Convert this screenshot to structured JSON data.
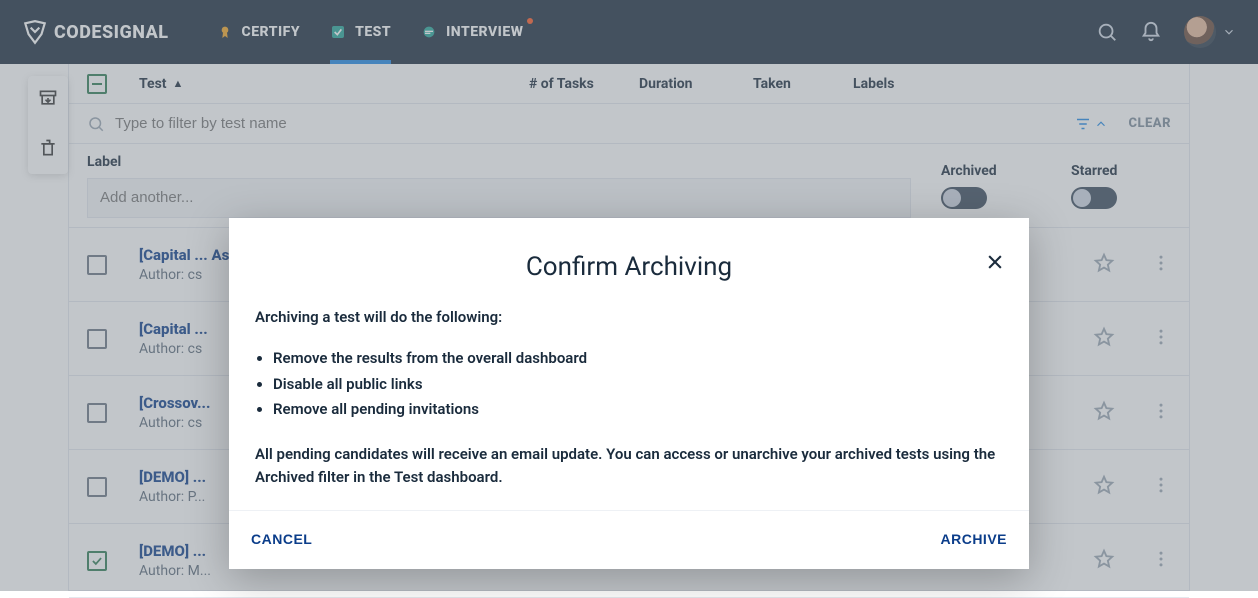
{
  "brand": "CODESIGNAL",
  "nav": {
    "certify": "CERTIFY",
    "test": "TEST",
    "interview": "INTERVIEW"
  },
  "columns": {
    "test": "Test",
    "tasks": "# of Tasks",
    "duration": "Duration",
    "taken": "Taken",
    "labels": "Labels"
  },
  "filter": {
    "placeholder": "Type to filter by test name",
    "clear": "CLEAR"
  },
  "subfilter": {
    "label_heading": "Label",
    "label_placeholder": "Add another...",
    "archived": "Archived",
    "starred": "Starred"
  },
  "rows": [
    {
      "title": "[Capital ... Assessm...",
      "author": "Author: cs",
      "checked": false
    },
    {
      "title": "[Capital ...",
      "author": "Author: cs",
      "checked": false
    },
    {
      "title": "[Crossov...",
      "author": "Author: cs",
      "checked": false
    },
    {
      "title": "[DEMO] ...",
      "author": "Author: P...",
      "checked": false
    },
    {
      "title": "[DEMO] ...",
      "author": "Author: M...",
      "checked": true
    }
  ],
  "modal": {
    "title": "Confirm Archiving",
    "intro": "Archiving a test will do the following:",
    "bullets": [
      "Remove the results from the overall dashboard",
      "Disable all public links",
      "Remove all pending invitations"
    ],
    "note": "All pending candidates will receive an email update. You can access or unarchive your archived tests using the Archived filter in the Test dashboard.",
    "cancel": "CANCEL",
    "archive": "ARCHIVE"
  }
}
